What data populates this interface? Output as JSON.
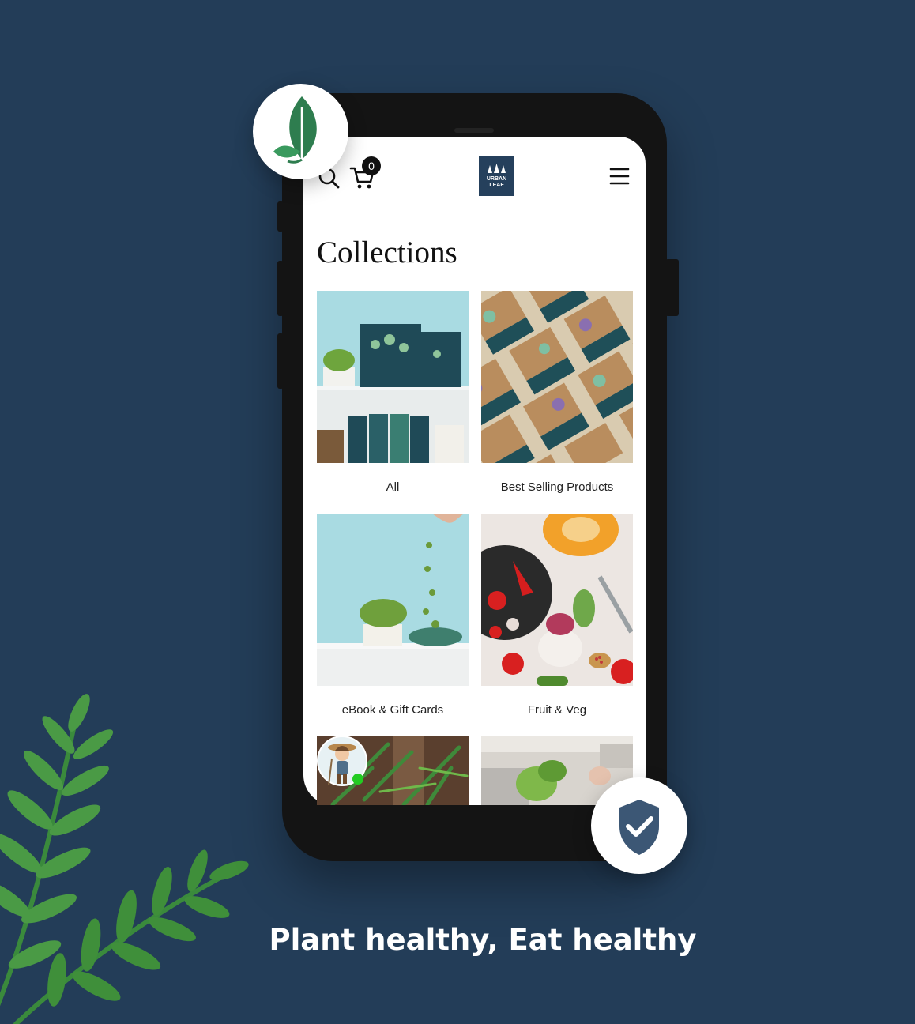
{
  "header": {
    "cart_count": "0",
    "logo_text": "URBAN LEAF"
  },
  "page": {
    "title": "Collections"
  },
  "collections": [
    {
      "label": "All"
    },
    {
      "label": "Best Selling Products"
    },
    {
      "label": "eBook & Gift Cards"
    },
    {
      "label": "Fruit & Veg"
    }
  ],
  "promo": {
    "tagline": "Plant healthy, Eat healthy"
  },
  "colors": {
    "background": "#233d58",
    "brand_navy": "#25405c",
    "leaf_green": "#2e7d4f",
    "online_dot": "#22cc22"
  },
  "icons": {
    "top_badge": "leaf-icon",
    "bottom_badge": "shield-check-icon"
  }
}
